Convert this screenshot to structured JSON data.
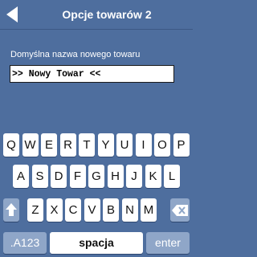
{
  "header": {
    "title": "Opcje towarów 2"
  },
  "form": {
    "label": "Domyślna nazwa nowego towaru",
    "input_value": ">> Nowy Towar <<"
  },
  "keyboard": {
    "row1": [
      "Q",
      "W",
      "E",
      "R",
      "T",
      "Y",
      "U",
      "I",
      "O",
      "P"
    ],
    "row2": [
      "A",
      "S",
      "D",
      "F",
      "G",
      "H",
      "J",
      "K",
      "L"
    ],
    "row3": [
      "Z",
      "X",
      "C",
      "V",
      "B",
      "N",
      "M"
    ],
    "mode_label": ".A123",
    "space_label": "spacja",
    "enter_label": "enter"
  },
  "icons": {
    "back": "back-arrow-icon",
    "shift": "shift-arrow-icon",
    "backspace": "backspace-icon"
  },
  "colors": {
    "background": "#4e6e9e",
    "key": "#ffffff",
    "special_key": "#8fa6c8"
  }
}
